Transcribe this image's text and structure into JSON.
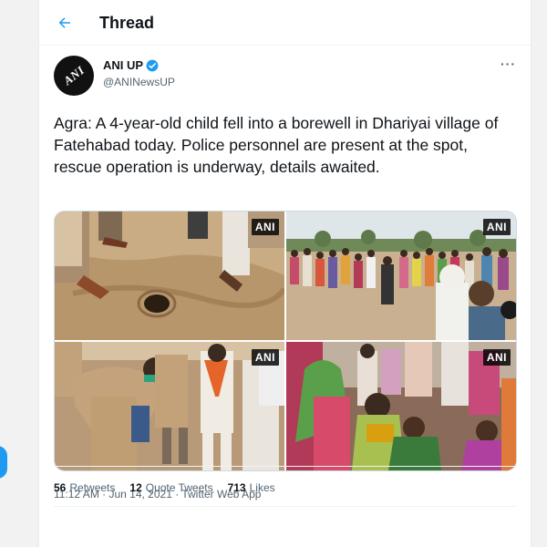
{
  "header": {
    "title": "Thread",
    "back_icon": "arrow-left-icon"
  },
  "tweet": {
    "author_name": "ANI UP",
    "author_handle": "@ANINewsUP",
    "avatar_text": "ANI",
    "text": "Agra: A 4-year-old child fell into a borewell in Dhariyai village of Fatehabad today. Police personnel are present at the spot, rescue operation is underway, details awaited.",
    "more_label": "···",
    "images": [
      {
        "watermark": "ANI",
        "description": "borewell-hole-with-people-feet"
      },
      {
        "watermark": "ANI",
        "description": "crowd-in-field"
      },
      {
        "watermark": "ANI",
        "description": "police-looking-into-borewell"
      },
      {
        "watermark": "ANI",
        "description": "women-gathered-crying"
      }
    ],
    "timestamp": "11:12 AM · Jun 14, 2021",
    "source": "Twitter Web App",
    "meta_separator": " · "
  },
  "stats": {
    "retweets_count": "56",
    "retweets_label": "Retweets",
    "quotes_count": "12",
    "quotes_label": "Quote Tweets",
    "likes_count": "713",
    "likes_label": "Likes"
  },
  "colors": {
    "accent": "#1d9bf0",
    "text": "#0f1419",
    "secondary": "#536471"
  }
}
